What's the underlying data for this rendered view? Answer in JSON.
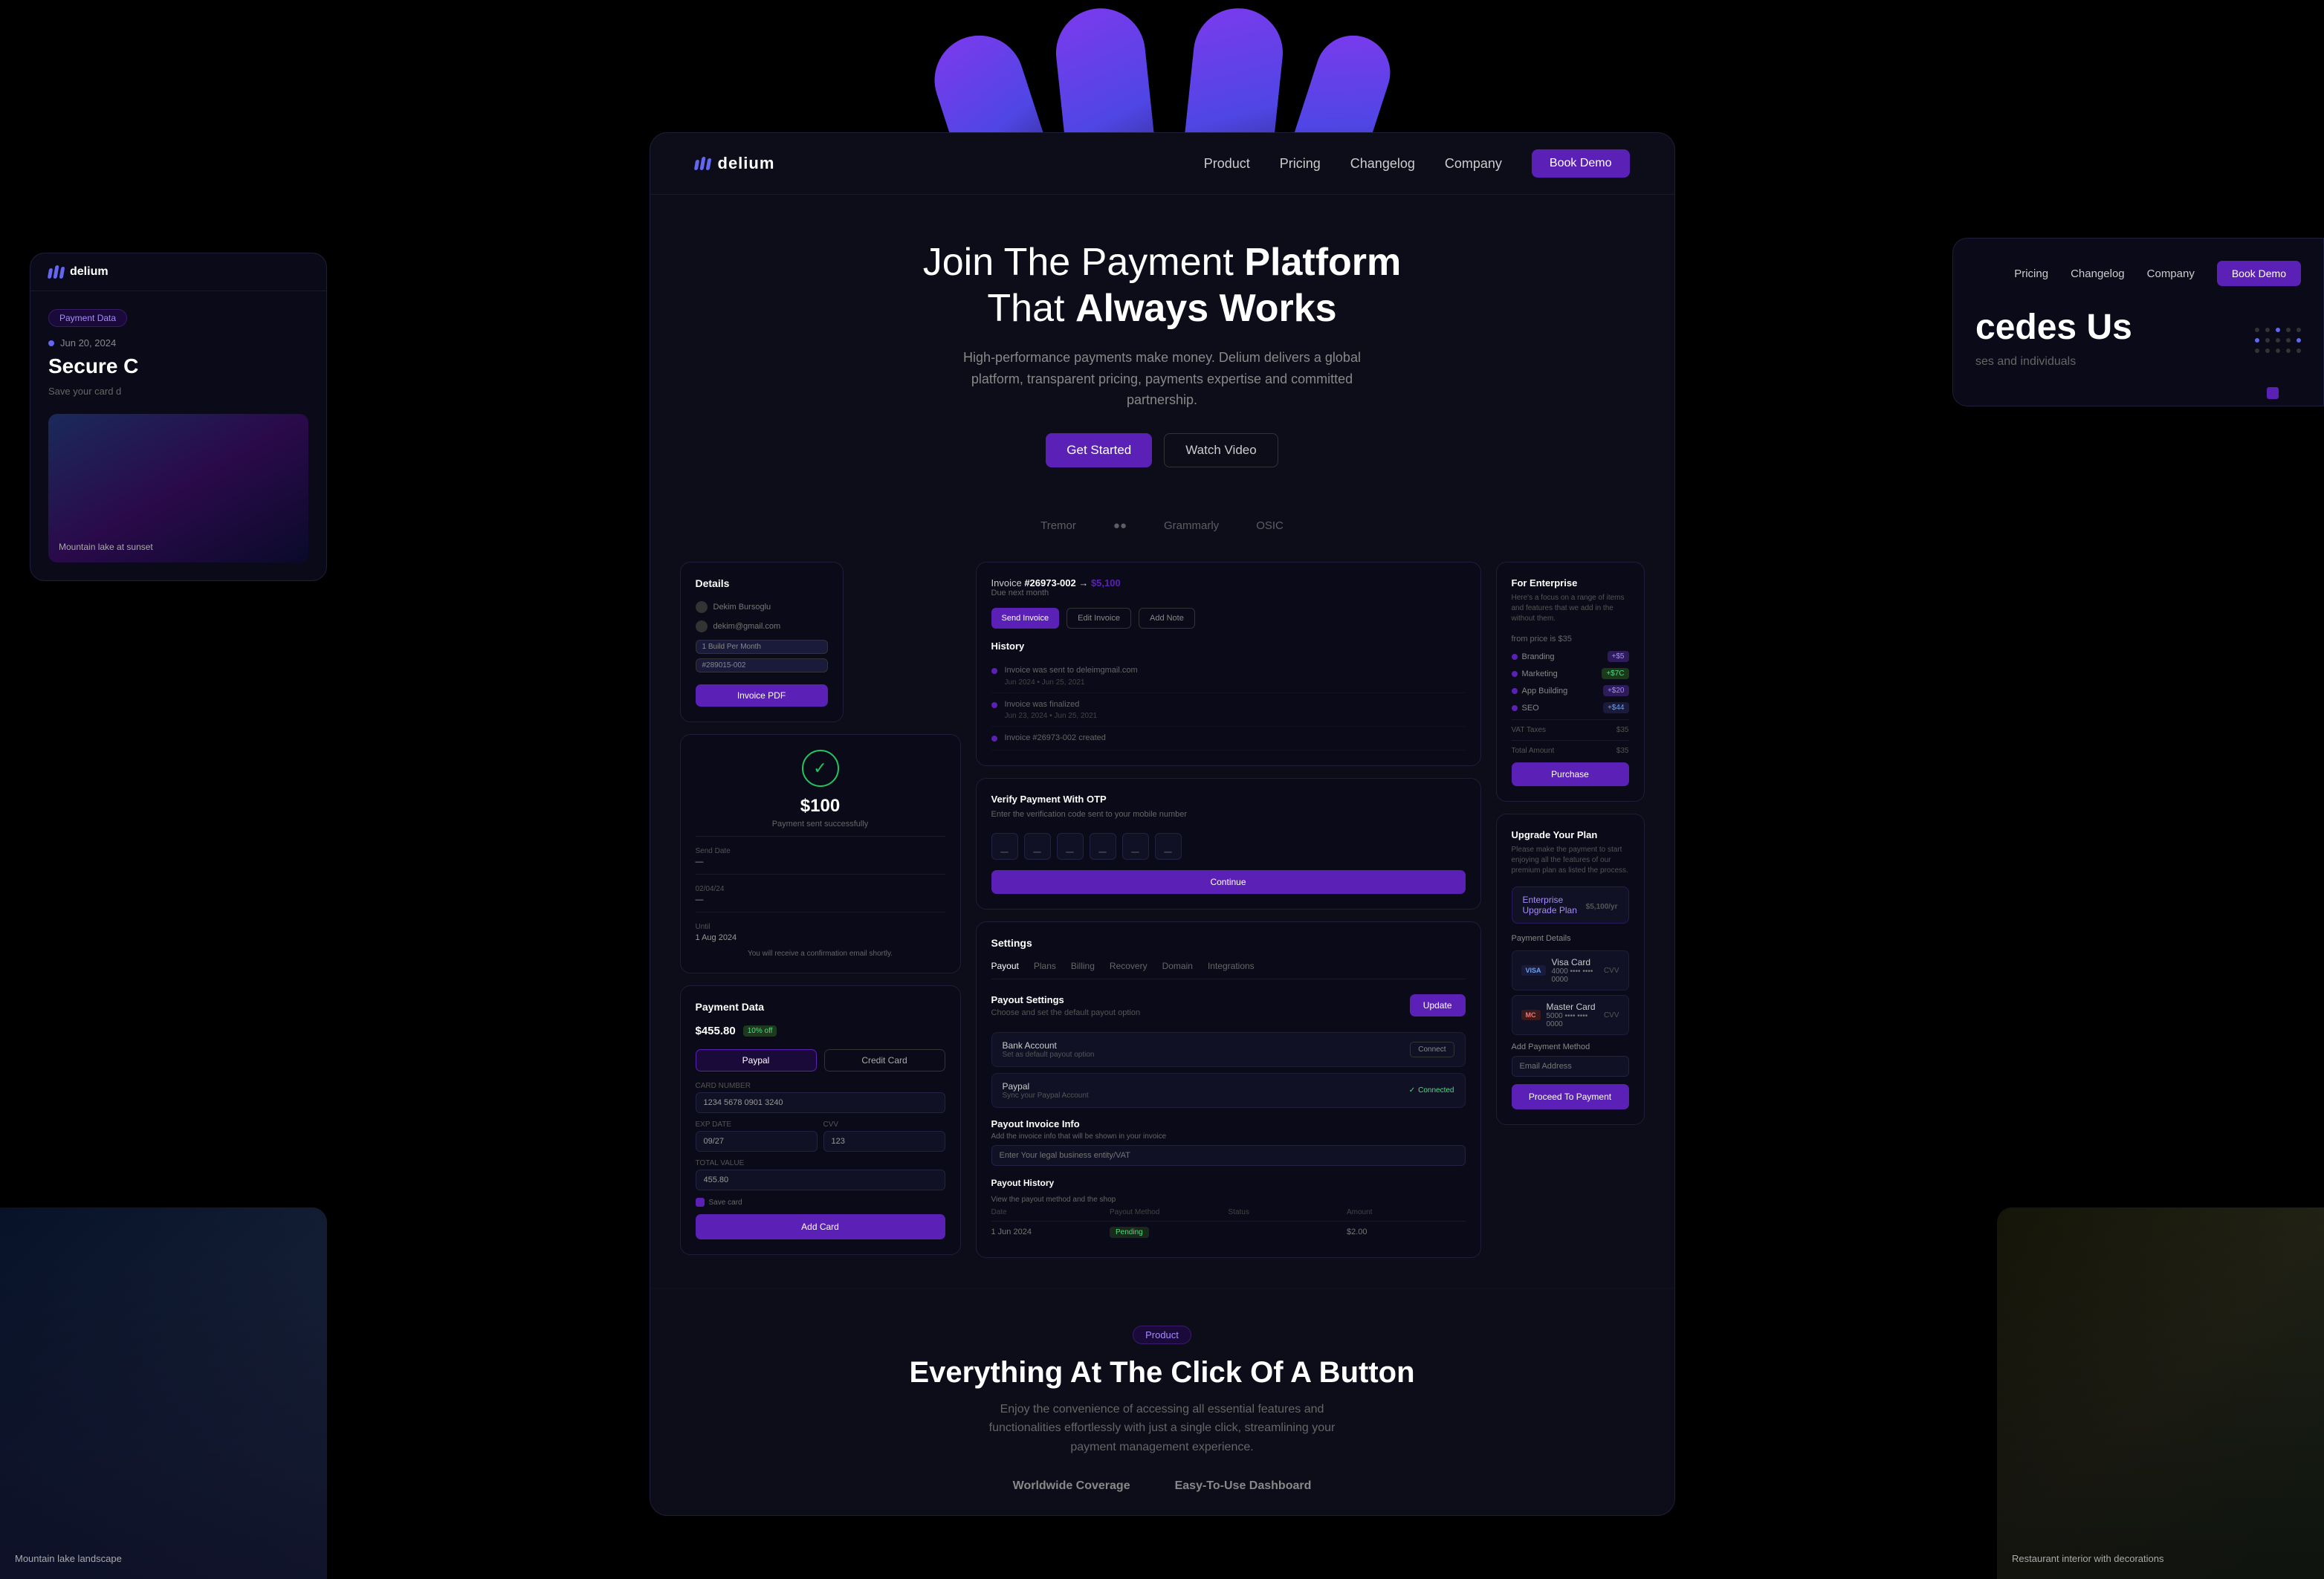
{
  "brand": {
    "name": "delium",
    "logo_icon": "///",
    "tagline": "Payment Platform"
  },
  "nav": {
    "links": [
      "Product",
      "Pricing",
      "Changelog",
      "Company"
    ],
    "cta": "Book Demo"
  },
  "hero": {
    "title_part1": "Join The Payment",
    "title_bold1": "Platform",
    "title_part2": "That",
    "title_bold2": "Always Works",
    "description": "High-performance payments make money. Delium delivers a global platform, transparent pricing, payments expertise and committed partnership.",
    "btn_start": "Get Started",
    "btn_video": "Watch Video"
  },
  "trust": {
    "logos": [
      "Tremor",
      "●●",
      "Grammarly",
      "OSIC"
    ]
  },
  "invoice": {
    "number": "#26973-002",
    "amount": "$5,100",
    "due_text": "Due next month",
    "btn_send": "Send Invoice",
    "btn_edit": "Edit Invoice",
    "btn_note": "Add Note",
    "history_title": "History",
    "history": [
      {
        "text": "Invoice was sent to deleimgmail.com",
        "time": "Jun 2024 • Jun 25, 2021"
      },
      {
        "text": "Invoice was finalized",
        "time": "Jun 23, 2024 • Jun 25, 2021"
      },
      {
        "text": "Invoice #26973-002 created",
        "time": ""
      }
    ]
  },
  "otp": {
    "title": "Verify Payment With OTP",
    "description": "Enter the verification code sent to your mobile number",
    "btn_continue": "Continue"
  },
  "details": {
    "title": "Details",
    "name": "Dekim Bursoglu",
    "email": "dekim@gmail.com",
    "plan": "1 Build Per Month",
    "code": "#289015-002",
    "btn_pdf": "Invoice PDF"
  },
  "payment_success": {
    "amount": "$100",
    "label": "Payment sent successfully"
  },
  "payment_data": {
    "title": "Payment Data",
    "price": "$455.80",
    "discount": "10% off",
    "method1": "Paypal",
    "method2": "Credit Card",
    "card_number_label": "CARD NUMBER",
    "card_number": "1234 5678 0901 3240",
    "exp_label": "EXP DATE",
    "exp": "09/27",
    "cvv_label": "CVV",
    "cvv": "123",
    "total_label": "TOTAL VALUE",
    "total": "455.80",
    "save_label": "Save card",
    "btn_add": "Add Card"
  },
  "settings": {
    "title": "Settings",
    "tabs": [
      "Payout",
      "Plans",
      "Billing",
      "Recovery",
      "Domain",
      "Integrations"
    ],
    "payout_settings_label": "Payout Settings",
    "payout_settings_desc": "Choose and set the default payout option",
    "btn_update": "Update",
    "methods": [
      {
        "name": "Bank Account",
        "detail": "Set as default payout option",
        "action": "Connect",
        "connected": false
      },
      {
        "name": "Paypal",
        "detail": "Sync your Paypal Account",
        "action": "Connected",
        "connected": true
      }
    ],
    "invoice_info_label": "Payout Invoice Info",
    "invoice_info_desc": "Add the invoice info that will be shown in your invoice",
    "invoice_placeholder": "Enter Your legal business entity/VAT",
    "payout_history_title": "Payout History",
    "ph_desc": "View the payout method and the shop",
    "ph_headers": [
      "Date",
      "Payout Method",
      "Status",
      "Amount"
    ],
    "ph_rows": [
      {
        "date": "1 Jun 2024",
        "method": "",
        "status": "Pending",
        "amount": "$2.00"
      }
    ]
  },
  "enterprise": {
    "title": "For Enterprise",
    "description": "Here's a focus on a range of items and features that we add in the without them.",
    "from_price": "from price is $35",
    "features": [
      {
        "name": "Branding",
        "badge": "+$5",
        "badge_type": "purple"
      },
      {
        "name": "Marketing",
        "badge": "+$7C",
        "badge_type": "green"
      },
      {
        "name": "App Building",
        "badge": "+$20",
        "badge_type": "purple"
      },
      {
        "name": "SEO",
        "badge": "+$44",
        "badge_type": "blue"
      }
    ],
    "vat_label": "VAT Taxes",
    "vat_value": "$35",
    "total_label": "Total Amount",
    "total_value": "$35",
    "btn_purchase": "Purchase"
  },
  "upgrade": {
    "title": "Upgrade Your Plan",
    "description": "Please make the payment to start enjoying all the features of our premium plan as listed the process.",
    "plan_name": "Enterprise Upgrade Plan",
    "plan_price": "$5,100",
    "plan_per": "/yr",
    "payment_details_title": "Payment Details",
    "cards": [
      {
        "brand": "VISA",
        "number": "Visa Card",
        "mask": "4000 •••• •••• 0000",
        "cvv": "CVV",
        "type": "visa"
      },
      {
        "brand": "MC",
        "number": "Master Card",
        "mask": "5000 •••• •••• 0000",
        "cvv": "CVV",
        "type": "mc"
      }
    ],
    "add_payment_label": "Add Payment Method",
    "email_placeholder": "Email Address",
    "btn_proceed": "Proceed To Payment"
  },
  "left_side": {
    "date": "Jun 20, 2024",
    "title": "Secure C",
    "desc": "Save your card d",
    "badge": "Payment Data"
  },
  "right_side": {
    "nav_links": [
      "Pricing",
      "Changelog",
      "Company"
    ],
    "nav_cta": "Book Demo",
    "title": "cedes Us",
    "subtitle": "ses and individuals"
  },
  "bottom": {
    "badge": "Product",
    "title": "Everything At The Click Of A Button",
    "description": "Enjoy the convenience of accessing all essential features and functionalities effortlessly with just a single click, streamlining your payment management experience.",
    "features": [
      "Worldwide Coverage",
      "Easy-To-Use Dashboard"
    ]
  },
  "worldwide": {
    "label": "Worldwide Coverage"
  }
}
